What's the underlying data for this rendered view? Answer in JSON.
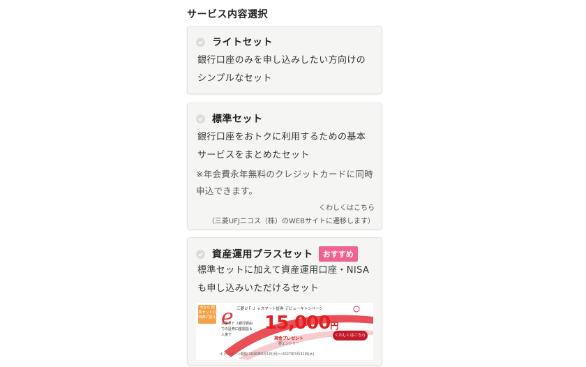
{
  "section": {
    "title": "サービス内容選択"
  },
  "options": [
    {
      "title": "ライトセット",
      "description": "銀行口座のみを申し込みしたい方向けのシンプルなセット"
    },
    {
      "title": "標準セット",
      "description": "銀行口座をおトクに利用するための基本サービスをまとめたセット",
      "note": "※年会費永年無料のクレジットカードに同時申込できます。",
      "link_text": "くわしくはこちら",
      "link_note": "（三菱UFJニコス（株）のWEBサイトに遷移します）"
    },
    {
      "title": "資産運用プラスセット",
      "badge": "おすすめ",
      "description": "標準セットに加えて資産運用口座・NISAも申し込みいただけるセット"
    }
  ],
  "banner": {
    "tag": "今なら 標準セットの 特典に加え",
    "campaign": "三菱ＵＦＪ ｅスマート証券 デビューキャンペーン",
    "side_text": "三菱ＵＦＪ銀行経由での証券口座開設＆入金で",
    "amount": "15,000",
    "yen": "円",
    "present": "現金プレゼント",
    "entry": "要エントリー",
    "button": "くわしくはこちら",
    "period": "キャンペーン期間 2026年6月1日(月)〜2027年3月31日(水)"
  },
  "colors": {
    "badge": "#f06292",
    "card_bg": "#f5f5f4",
    "banner_red": "#e02020"
  }
}
